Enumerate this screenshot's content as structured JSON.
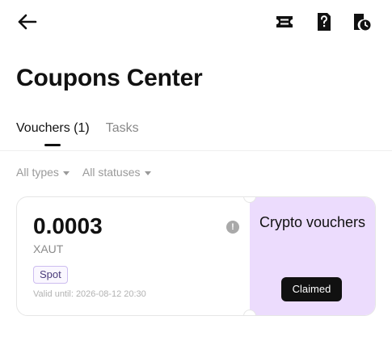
{
  "header": {
    "back_icon": "arrow-left-icon",
    "right_icons": [
      "ticket-icon",
      "question-document-icon",
      "history-icon"
    ]
  },
  "page_title": "Coupons Center",
  "tabs": [
    {
      "label": "Vouchers (1)",
      "active": true
    },
    {
      "label": "Tasks",
      "active": false
    }
  ],
  "filters": [
    {
      "label": "All types"
    },
    {
      "label": "All statuses"
    }
  ],
  "vouchers": [
    {
      "amount": "0.0003",
      "currency": "XAUT",
      "tag": "Spot",
      "valid_label": "Valid until:",
      "valid_date": "2026-08-12 20:30",
      "info_icon": "!",
      "type_label": "Crypto vouchers",
      "status": "Claimed"
    }
  ],
  "colors": {
    "accent_bg": "#ecdcfd",
    "status_bg": "#111111",
    "tag_border": "#cdbdf0"
  }
}
